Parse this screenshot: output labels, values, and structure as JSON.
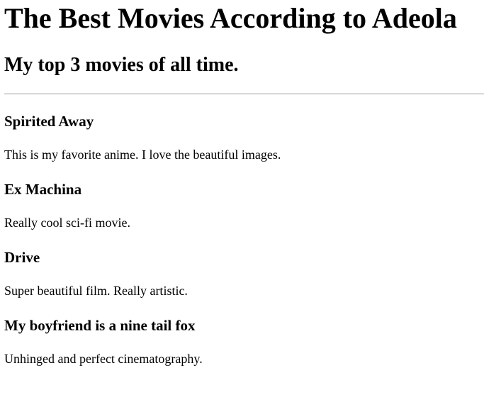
{
  "header": {
    "title": "The Best Movies According to Adeola",
    "subtitle": "My top 3 movies of all time."
  },
  "movies": [
    {
      "title": "Spirited Away",
      "description": "This is my favorite anime. I love the beautiful images."
    },
    {
      "title": "Ex Machina",
      "description": "Really cool sci-fi movie."
    },
    {
      "title": "Drive",
      "description": "Super beautiful film. Really artistic."
    },
    {
      "title": "My boyfriend is a nine tail fox",
      "description": "Unhinged and perfect cinematography."
    }
  ]
}
